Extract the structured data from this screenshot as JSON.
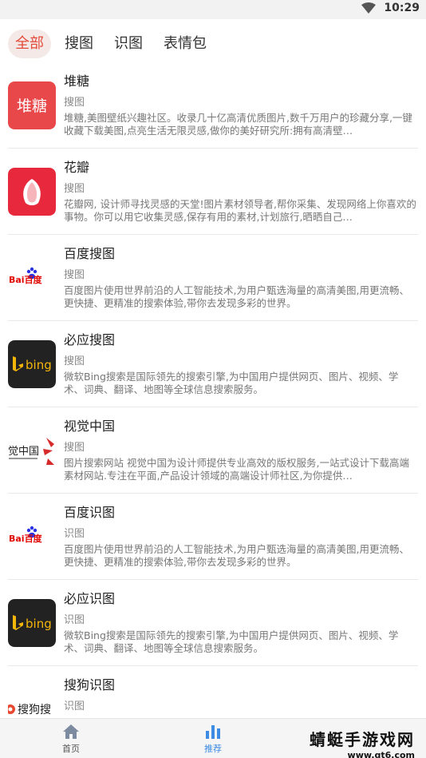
{
  "status_bar": {
    "time": "10:29"
  },
  "tabs": [
    {
      "label": "全部",
      "active": true
    },
    {
      "label": "搜图",
      "active": false
    },
    {
      "label": "识图",
      "active": false
    },
    {
      "label": "表情包",
      "active": false
    }
  ],
  "items": [
    {
      "title": "堆糖",
      "category": "搜图",
      "logo_text": "堆糖",
      "description": "堆糖,美图壁纸兴趣社区。收录几十亿高清优质图片,数千万用户的珍藏分享,一键收藏下载美图,点亮生活无限灵感,做你的美好研究所:拥有高清壁…"
    },
    {
      "title": "花瓣",
      "category": "搜图",
      "description": "花瓣网, 设计师寻找灵感的天堂!图片素材领导者,帮你采集、发现网络上你喜欢的事物。你可以用它收集灵感,保存有用的素材,计划旅行,晒晒自己…"
    },
    {
      "title": "百度搜图",
      "category": "搜图",
      "logo_text": "Bai百度",
      "description": "百度图片使用世界前沿的人工智能技术,为用户甄选海量的高清美图,用更流畅、更快捷、更精准的搜索体验,带你去发现多彩的世界。"
    },
    {
      "title": "必应搜图",
      "category": "搜图",
      "logo_text": "bing",
      "description": "微软Bing搜索是国际领先的搜索引擎,为中国用户提供网页、图片、视频、学术、词典、翻译、地图等全球信息搜索服务。"
    },
    {
      "title": "视觉中国",
      "category": "搜图",
      "logo_text": "觉中国",
      "description": "图片搜索网站 视觉中国为设计师提供专业高效的版权服务,一站式设计下载高端素材网站.专注在平面,产品设计领域的高端设计师社区,为你提供…"
    },
    {
      "title": "百度识图",
      "category": "识图",
      "logo_text": "Bai百度",
      "description": "百度图片使用世界前沿的人工智能技术,为用户甄选海量的高清美图,用更流畅、更快捷、更精准的搜索体验,带你去发现多彩的世界。"
    },
    {
      "title": "必应识图",
      "category": "识图",
      "logo_text": "bing",
      "description": "微软Bing搜索是国际领先的搜索引擎,为中国用户提供网页、图片、视频、学术、词典、翻译、地图等全球信息搜索服务。"
    },
    {
      "title": "搜狗识图",
      "category": "识图",
      "logo_text": "搜狗搜",
      "description": ""
    }
  ],
  "bottom_nav": [
    {
      "label": "首页",
      "icon": "home-icon",
      "active": false
    },
    {
      "label": "推荐",
      "icon": "bar-chart-icon",
      "active": true
    }
  ],
  "watermark": {
    "text": "蜻蜓手游戏网",
    "url": "www.qt6.com"
  },
  "colors": {
    "accent": "#e34b3a",
    "active_tab_bg": "#f4e9e7",
    "nav_active": "#3d8be3",
    "duitang_red": "#e9484a",
    "huaban_red": "#e8283c",
    "bing_bg": "#222222"
  }
}
